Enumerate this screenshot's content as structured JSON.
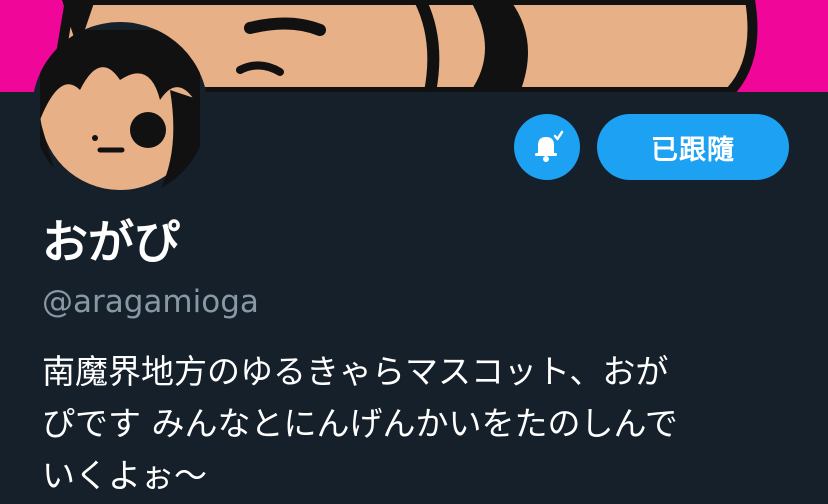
{
  "profile": {
    "follow_button_label": "已跟隨",
    "display_name": "おがぴ",
    "handle": "@aragamioga",
    "bio": "南魔界地方のゆるきゃらマスコット、おが\nぴです みんなとにんげんかいをたのしんで\nいくよぉ～"
  },
  "icons": {
    "notification": "bell-check-icon"
  },
  "colors": {
    "background": "#15202b",
    "banner": "#f0079a",
    "accent": "#1da1f2",
    "secondary_text": "#8899a6"
  }
}
